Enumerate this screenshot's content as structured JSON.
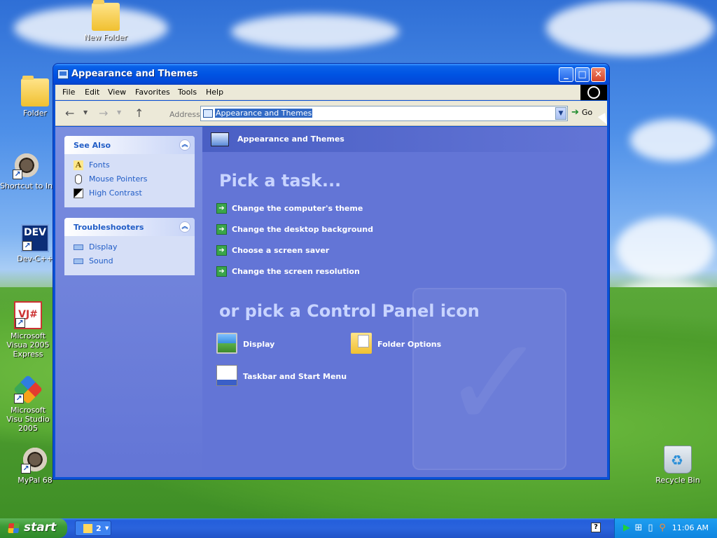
{
  "desktop": {
    "icons": [
      {
        "label": "New Folder"
      },
      {
        "label": "Folder"
      },
      {
        "label": "Shortcut to Inte"
      },
      {
        "label": "Dev-C++"
      },
      {
        "label": "Microsoft Visua 2005 Express"
      },
      {
        "label": "Microsoft Visu Studio 2005"
      },
      {
        "label": "MyPal 68"
      },
      {
        "label": "Recycle Bin"
      }
    ]
  },
  "window": {
    "title": "Appearance and Themes",
    "menu": [
      "File",
      "Edit",
      "View",
      "Favorites",
      "Tools",
      "Help"
    ],
    "address": {
      "label": "Address",
      "value": "Appearance and Themes",
      "go_label": "Go"
    },
    "left_pane": {
      "see_also": {
        "title": "See Also",
        "items": [
          "Fonts",
          "Mouse Pointers",
          "High Contrast"
        ]
      },
      "troubleshooters": {
        "title": "Troubleshooters",
        "items": [
          "Display",
          "Sound"
        ]
      }
    },
    "main": {
      "header_title": "Appearance and Themes",
      "pick_task_heading": "Pick a task...",
      "tasks": [
        "Change the computer's theme",
        "Change the desktop background",
        "Choose a screen saver",
        "Change the screen resolution"
      ],
      "pick_icon_heading": "or pick a Control Panel icon",
      "icons": [
        "Display",
        "Folder Options",
        "Taskbar and Start Menu"
      ]
    }
  },
  "taskbar": {
    "start_label": "start",
    "group_count": "2",
    "clock": "11:06 AM"
  }
}
